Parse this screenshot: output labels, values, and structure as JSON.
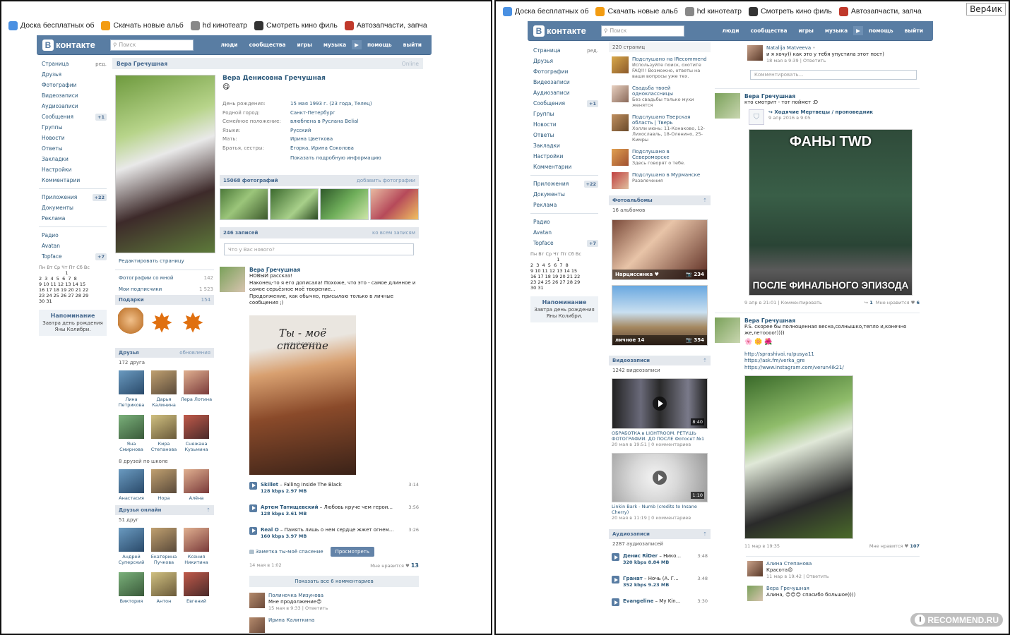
{
  "bookmarks_left": [
    {
      "label": "Доска бесплатных об",
      "icon": "bookmark-multicolor-icon",
      "color": "#4a90e2"
    },
    {
      "label": "Скачать новые альб",
      "icon": "music-note-icon",
      "color": "#f39c12"
    },
    {
      "label": "hd кинотеатр",
      "icon": "hd-icon",
      "color": "#888888"
    },
    {
      "label": "Смотреть кино филь",
      "icon": "mask-icon",
      "color": "#333333"
    },
    {
      "label": "Автозапчасти, запча",
      "icon": "gear-icon",
      "color": "#c0392b"
    }
  ],
  "bookmarks_right": [
    {
      "label": "Доска бесплатных об",
      "icon": "bookmark-multicolor-icon",
      "color": "#4a90e2"
    },
    {
      "label": "Скачать новые альб",
      "icon": "music-note-icon",
      "color": "#f39c12"
    },
    {
      "label": "hd кинотеатр",
      "icon": "hd-icon",
      "color": "#888888"
    },
    {
      "label": "Смотреть кино филь",
      "icon": "mask-icon",
      "color": "#333333"
    },
    {
      "label": "Автозапчасти, запча",
      "icon": "gear-icon",
      "color": "#c0392b"
    }
  ],
  "corner_tooltip": "Вер4ик",
  "header": {
    "logo": "контакте",
    "logo_letter": "В",
    "search_placeholder": "Поиск",
    "nav": [
      "люди",
      "сообщества",
      "игры",
      "музыка",
      "помощь",
      "выйти"
    ]
  },
  "sidebar": {
    "items": [
      {
        "label": "Страница",
        "extra": "ред."
      },
      {
        "label": "Друзья",
        "extra": ""
      },
      {
        "label": "Фотографии",
        "extra": ""
      },
      {
        "label": "Видеозаписи",
        "extra": ""
      },
      {
        "label": "Аудиозаписи",
        "extra": ""
      },
      {
        "label": "Сообщения",
        "extra": "+1"
      },
      {
        "label": "Группы",
        "extra": ""
      },
      {
        "label": "Новости",
        "extra": ""
      },
      {
        "label": "Ответы",
        "extra": ""
      },
      {
        "label": "Закладки",
        "extra": ""
      },
      {
        "label": "Настройки",
        "extra": ""
      },
      {
        "label": "Комментарии",
        "extra": ""
      }
    ],
    "apps": [
      {
        "label": "Приложения",
        "extra": "+22"
      },
      {
        "label": "Документы",
        "extra": ""
      },
      {
        "label": "Реклама",
        "extra": ""
      }
    ],
    "extra": [
      {
        "label": "Радио",
        "extra": ""
      },
      {
        "label": "Avatan",
        "extra": ""
      },
      {
        "label": "Topface",
        "extra": "+7"
      }
    ],
    "calendar": {
      "days": "Пн Вт Ср Чт Пт Сб Вс",
      "rows": [
        "                  1",
        "2  3  4  5  6  7  8",
        "9 10 11 12 13 14 15",
        "16 17 18 19 20 21 22",
        "23 24 25 26 27 28 29",
        "30 31"
      ]
    },
    "reminder_title": "Напоминание",
    "reminder_text": "Завтра день рождения Яны Колибри."
  },
  "profile": {
    "header_name": "Вера Гречушная",
    "status": "Online",
    "full_name": "Вера Денисовна Гречушная",
    "fields": [
      {
        "k": "День рождения:",
        "v": "15 мая 1993 г. (23 года, Телец)"
      },
      {
        "k": "Родной город:",
        "v": "Санкт-Петербург"
      },
      {
        "k": "Семейное положение:",
        "v": "влюблена в Руслана Belial"
      },
      {
        "k": "Языки:",
        "v": "Русский"
      },
      {
        "k": "Мать:",
        "v": "Ирина Цветкова"
      },
      {
        "k": "Братья, сестры:",
        "v": "Егорка, Ирина Соколова"
      }
    ],
    "show_more": "Показать подробную информацию",
    "edit_page": "Редактировать страницу",
    "photos_with_me": "Фотографии со мной",
    "photos_with_me_count": "142",
    "subscriptions": "Мои подписчики",
    "subscriptions_count": "1 523",
    "gifts": "Подарки",
    "gifts_count": "154",
    "photos_bar": "15068 фотографий",
    "photos_add": "добавить фотографии",
    "wall_bar": "246 записей",
    "wall_all": "ко всем записям",
    "wall_input": "Что у Вас нового?"
  },
  "friends": {
    "title": "Друзья",
    "updates": "обновления",
    "count": "172 друга",
    "list": [
      "Лина Петрикова",
      "Дарья Калинина",
      "Лера Лотина",
      "Яна Смирнова",
      "Кира Степанова",
      "Снежана Кузьмина"
    ],
    "school_title": "8 друзей по школе",
    "school": [
      "Анастасия",
      "Нора",
      "Алёна"
    ],
    "online_title": "Друзья онлайн",
    "online_count": "51 друг",
    "online": [
      "Андрей Суперский",
      "Екатерина Пучкова",
      "Ксения Никитина",
      "Виктория",
      "Антон",
      "Евгений"
    ]
  },
  "post": {
    "author": "Вера Гречушная",
    "text": "НОВЫЙ рассказ!\nНаконец-то я его дописала! Похоже, что это - самое длинное и самое серьёзное моё творение...\nПродолжение, как обычно, присылаю только в личные сообщения ;)",
    "cover_title": "Ты - моё спасение",
    "cover_sub": "новый рассказ",
    "audio": [
      {
        "artist": "Skillet",
        "title": "Falling Inside The Black",
        "q": "128 kbps 2.97 MB",
        "d": "3:14"
      },
      {
        "artist": "Артем Татищевский",
        "title": "Любовь круче чем герои...",
        "q": "128 kbps 3.61 MB",
        "d": "3:56"
      },
      {
        "artist": "Real O",
        "title": "Память лишь о нем сердце жжет огнем...",
        "q": "160 kbps 3.97 MB",
        "d": "3:26"
      }
    ],
    "note": "Заметка ты-моё спасение",
    "view_btn": "Просмотреть",
    "date": "14 мая в 1:02",
    "likes_label": "Мне нравится",
    "likes": "13",
    "show_all": "Показать все 6 комментариев",
    "comments": [
      {
        "name": "Полиночка Мизунова",
        "text": "Мне продолжение😍",
        "meta": "15 мая в 9:33 | Ответить"
      },
      {
        "name": "Ирина Калиткина",
        "text": "",
        "meta": ""
      }
    ]
  },
  "mid": {
    "pages_count": "220 страниц",
    "publics": [
      {
        "name": "Подслушано на IRecommend",
        "desc": "Используйте поиск, охотите FAQ!!! Возможно, ответы на ваши вопросы уже тех."
      },
      {
        "name": "Свадьба твоей одноклассницы",
        "desc": "Без свадьбы только мухи женятся"
      },
      {
        "name": "Подслушано Тверская область | Тверь",
        "desc": "Холли июнь: 11-Конаково, 12-Лихославль, 18-Оленино, 25-Кимры"
      },
      {
        "name": "Подслушано в Североморске",
        "desc": "Здесь говорят о тебе."
      },
      {
        "name": "Подслушано в Мурманске",
        "desc": "Развлечения"
      }
    ],
    "albums_title": "Фотоальбомы",
    "albums_count": "16 альбомов",
    "albums": [
      {
        "name": "Нарциссинка ♥",
        "count": "234"
      },
      {
        "name": "личное 14",
        "count": "354"
      }
    ],
    "videos_title": "Видеозаписи",
    "videos_count": "1242 видеозаписи",
    "videos": [
      {
        "title": "ОБРАБОТКА в LIGHTROOM. РЕТУШЬ ФОТОГРАФИИ. ДО ПОСЛЕ Фотосет №1",
        "meta": "20 мая в 19:51 | 0 комментариев",
        "dur": "8:40"
      },
      {
        "title": "Linkin Bark - Numb (credits to Insane Cherry)",
        "meta": "20 мая в 11:19 | 0 комментариев",
        "dur": "1:10"
      }
    ],
    "audio_title": "Аудиозаписи",
    "audio_count": "2287 аудиозаписей",
    "audio": [
      {
        "artist": "Денис RiDer",
        "title": "Нико...",
        "q": "320 kbps 8.84 MB",
        "d": "3:48"
      },
      {
        "artist": "Гранат",
        "title": "Ночь (А. Г...",
        "q": "352 kbps 9.23 MB",
        "d": "3:48"
      },
      {
        "artist": "Evangeline",
        "title": "My Kin...",
        "q": "",
        "d": "3:30"
      }
    ]
  },
  "wall": {
    "top_comment": {
      "name": "Natalija Matveeva",
      "text": "и я хочу)) как это у тебя упустила этот пост)",
      "meta": "18 мая в 9:39 | Ответить"
    },
    "comment_placeholder": "Комментировать...",
    "posts": [
      {
        "author": "Вера Гречушная",
        "text": "кто смотрит - тот поймет :D",
        "repost": "Ходячие Мертвецы / проповедник",
        "repost_date": "9 апр 2016 в 9:05",
        "img_top": "ФАНЫ TWD",
        "img_bottom": "ПОСЛЕ ФИНАЛЬНОГО ЭПИЗОДА",
        "date": "9 апр в 21:01 | Комментировать",
        "reposts": "1",
        "likes": "6"
      },
      {
        "author": "Вера Гречушная",
        "text": "P.S. скорее бы полноценная весна,солнышко,тепло и,конечно же,летоооо!))))",
        "links": [
          "http://sprashivai.ru/pusya11",
          "https://ask.fm/verka_gre",
          "https://www.instagram.com/verun4ik21/"
        ],
        "date": "11 мар в 19:35",
        "likes": "107"
      }
    ],
    "comments": [
      {
        "name": "Алина Степанова",
        "text": "Красота😍",
        "meta": "11 мар в 19:42 | Ответить"
      },
      {
        "name": "Вера Гречушная",
        "text": "Алина, 😊😊😊 спасибо большое))))",
        "meta": ""
      }
    ],
    "likes_label": "Мне нравится"
  },
  "watermark": "RECOMMEND.RU",
  "watermark_letter": "I"
}
